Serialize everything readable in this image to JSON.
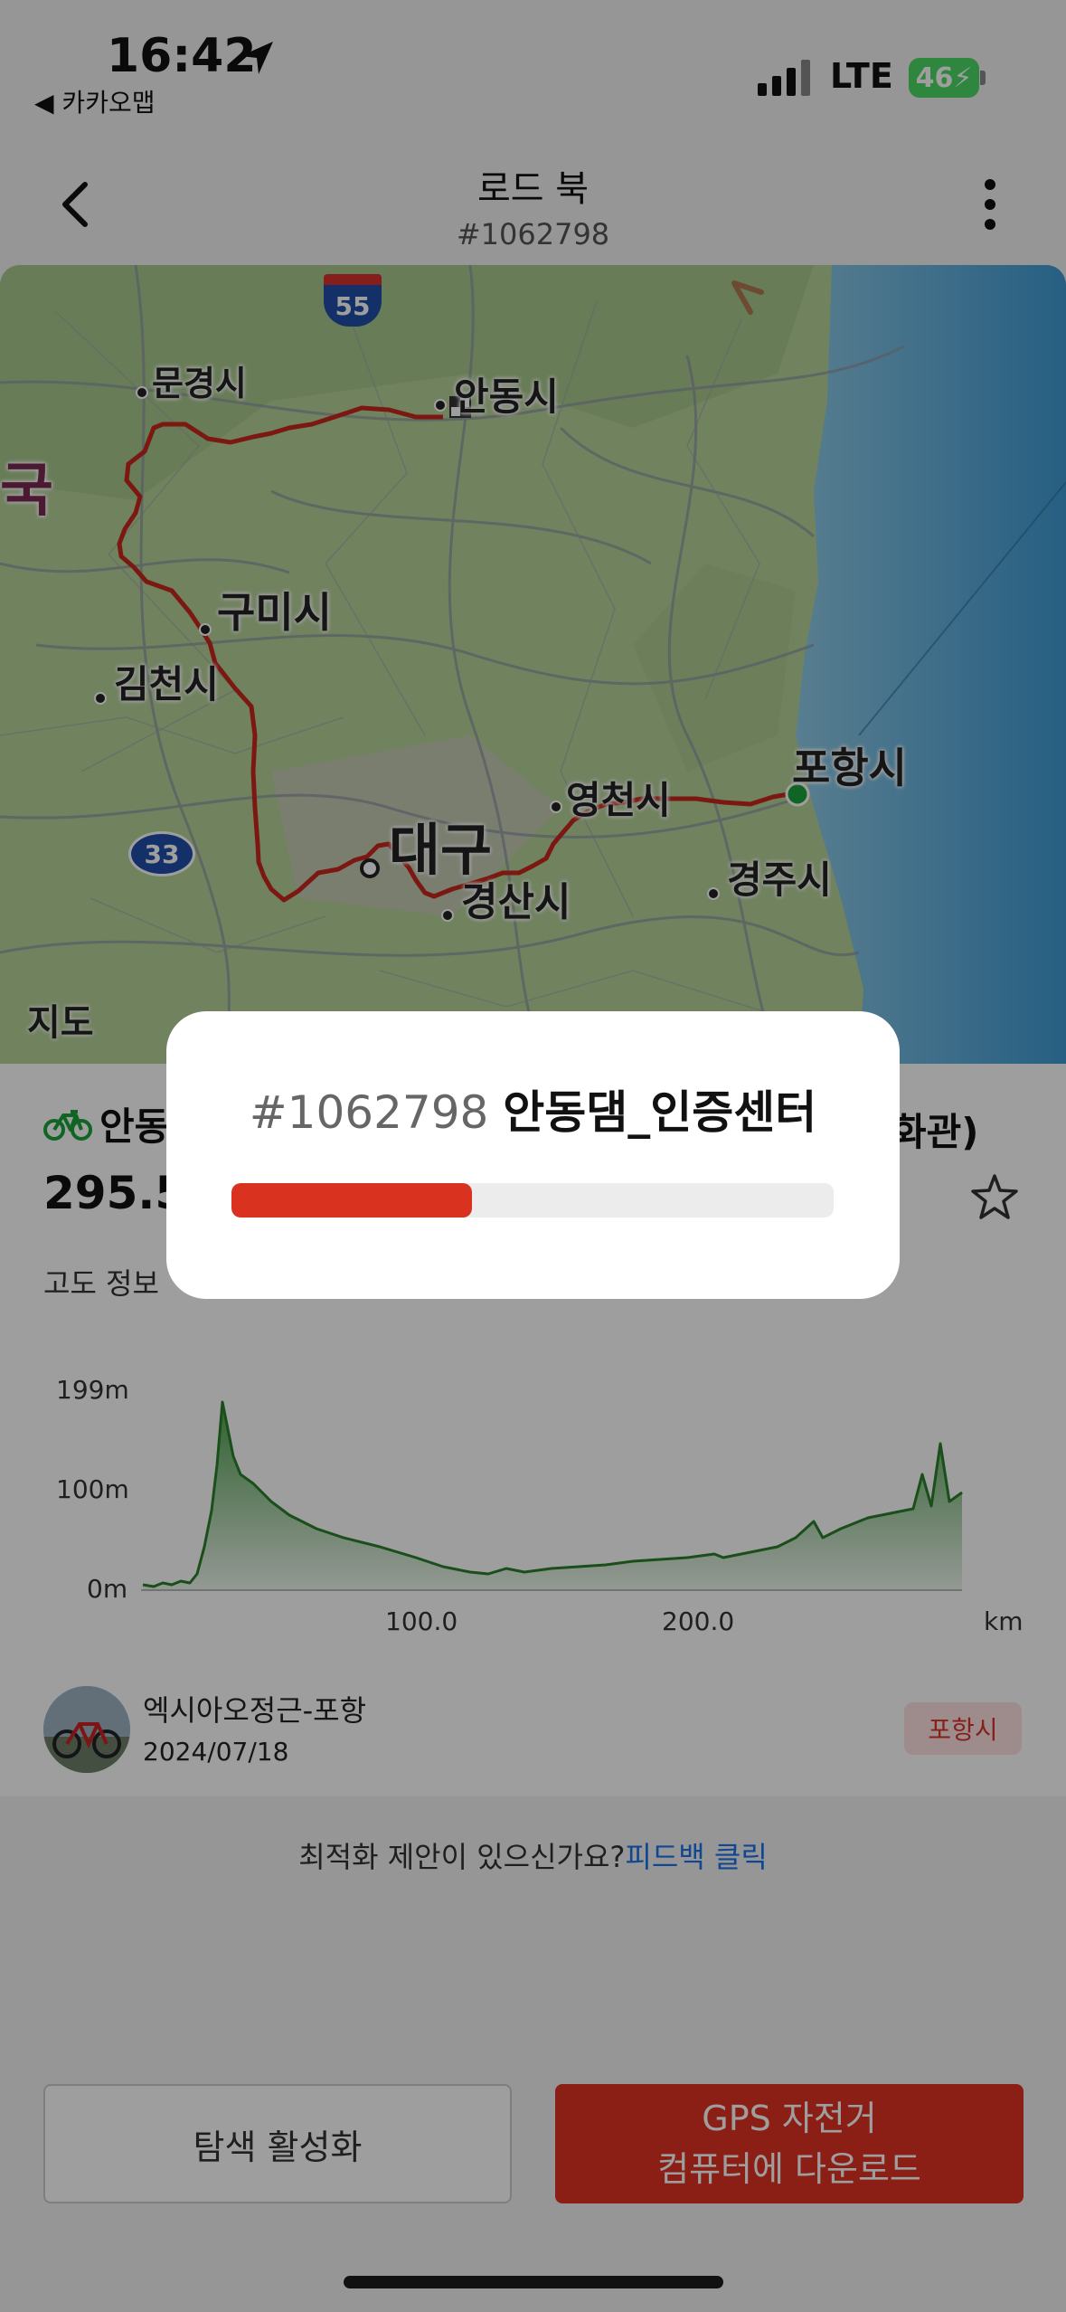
{
  "status_bar": {
    "time": "16:42",
    "back_app": "◀ 카카오맵",
    "network": "LTE",
    "battery": "46"
  },
  "nav": {
    "title": "로드 북",
    "subtitle": "#1062798"
  },
  "map": {
    "labels": {
      "mungyeong": "문경시",
      "andong": "안동시",
      "guk": "국",
      "gumi": "구미시",
      "gimcheon": "김천시",
      "pohang": "포항시",
      "yeongcheon": "영천시",
      "daegu": "대구",
      "gyeongsan": "경산시",
      "gyeongju": "경주시"
    },
    "shields": {
      "i55": "55",
      "r33": "33"
    },
    "attribution": "지도",
    "route_color": "#c8281e"
  },
  "route": {
    "name_visible": "안동",
    "name_tail": "화관)",
    "distance_visible": "295.5",
    "elevation_label": "고도 정보"
  },
  "elevation_chart": {
    "y_ticks": [
      "199m",
      "100m",
      "0m"
    ],
    "x_ticks": [
      "100.0",
      "200.0"
    ],
    "x_unit": "km"
  },
  "author": {
    "name": "엑시아오정근-포항",
    "date": "2024/07/18",
    "city_badge": "포항시"
  },
  "feedback": {
    "text": "최적화 제안이 있으신가요?",
    "link": "피드백 클릭"
  },
  "buttons": {
    "explore": "탐색 활성화",
    "download_line1": "GPS 자전거",
    "download_line2": "컴퓨터에 다운로드"
  },
  "modal": {
    "id": "#1062798",
    "name": "안동댐_인증센터",
    "progress": 0.4
  },
  "colors": {
    "accent_red": "#e13323",
    "link_blue": "#1a73e8",
    "chart_green": "#2f8f2f"
  }
}
